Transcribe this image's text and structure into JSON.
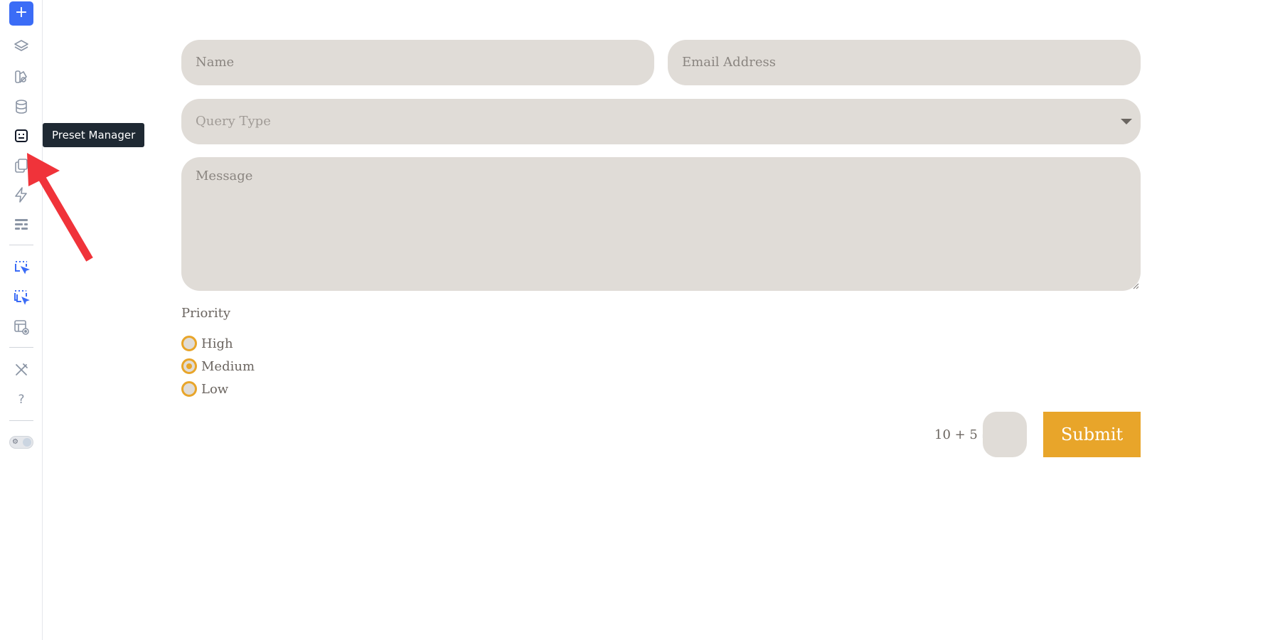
{
  "sidebar": {
    "add_label": "+",
    "items": [
      {
        "icon": "layers-icon"
      },
      {
        "icon": "palette-icon"
      },
      {
        "icon": "database-icon"
      },
      {
        "icon": "preset-manager-icon"
      },
      {
        "icon": "copy-icon"
      },
      {
        "icon": "lightning-icon"
      },
      {
        "icon": "form-list-icon"
      },
      {
        "icon": "select-element-icon"
      },
      {
        "icon": "select-multiple-icon"
      },
      {
        "icon": "template-preview-icon"
      },
      {
        "icon": "tools-icon"
      },
      {
        "icon": "help-icon"
      }
    ],
    "tooltip": "Preset Manager",
    "help_glyph": "?"
  },
  "form": {
    "name_placeholder": "Name",
    "email_placeholder": "Email Address",
    "query_type_placeholder": "Query Type",
    "message_placeholder": "Message",
    "priority_label": "Priority",
    "priority_options": [
      {
        "label": "High",
        "checked": false
      },
      {
        "label": "Medium",
        "checked": true
      },
      {
        "label": "Low",
        "checked": false
      }
    ],
    "captcha_question": "10 + 5",
    "captcha_equals": "=",
    "submit_label": "Submit"
  },
  "colors": {
    "accent": "#e8a52a",
    "field_bg": "#e0dcd7",
    "sidebar_accent": "#3b6cf6",
    "tooltip_bg": "#1f2933",
    "annotation_arrow": "#f0333a"
  }
}
